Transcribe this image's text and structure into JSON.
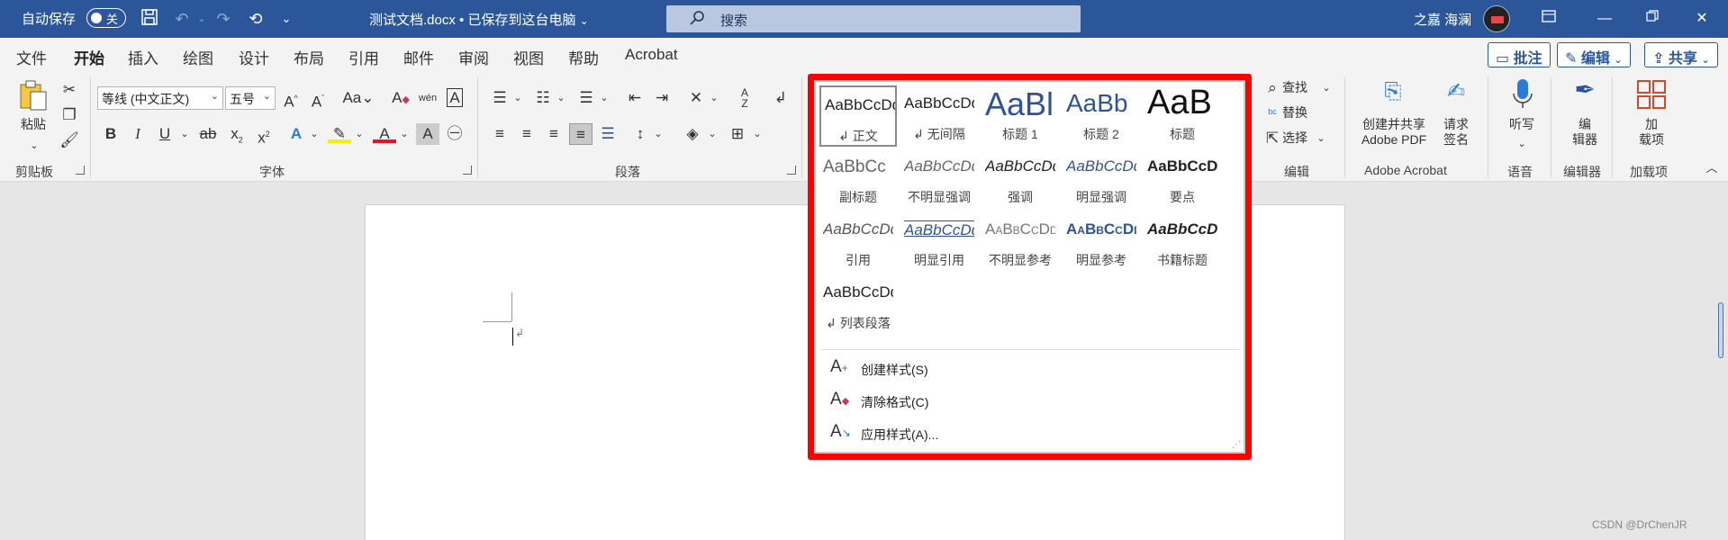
{
  "titlebar": {
    "autosave_label": "自动保存",
    "autosave_state": "关",
    "doc_title": "测试文档.docx • 已保存到这台电脑",
    "search_placeholder": "搜索",
    "user_name": "之嘉 海澜"
  },
  "tabs": [
    "文件",
    "开始",
    "插入",
    "绘图",
    "设计",
    "布局",
    "引用",
    "邮件",
    "审阅",
    "视图",
    "帮助",
    "Acrobat"
  ],
  "active_tab": "开始",
  "ribbon_actions": {
    "comment": "批注",
    "edit": "编辑",
    "share": "共享"
  },
  "groups": {
    "clipboard": {
      "label": "剪贴板",
      "paste": "粘贴"
    },
    "font": {
      "label": "字体",
      "font_name": "等线 (中文正文)",
      "font_size": "五号"
    },
    "paragraph": {
      "label": "段落"
    },
    "editing": {
      "label": "编辑",
      "find": "查找",
      "replace": "替换",
      "select": "选择"
    },
    "adobe": {
      "label": "Adobe Acrobat",
      "create_pdf": "创建并共享",
      "create_pdf2": "Adobe PDF",
      "request_sign": "请求",
      "request_sign2": "签名"
    },
    "voice": {
      "label": "语音",
      "dictate": "听写"
    },
    "editor": {
      "label": "编辑器",
      "editor_btn": "编",
      "editor_btn2": "辑器"
    },
    "addins": {
      "label": "加载项",
      "addins_btn": "加",
      "addins_btn2": "载项"
    }
  },
  "styles": [
    {
      "sample": "AaBbCcDd",
      "name": "↲ 正文"
    },
    {
      "sample": "AaBbCcDd",
      "name": "↲ 无间隔"
    },
    {
      "sample": "AaBl",
      "name": "标题 1"
    },
    {
      "sample": "AaBb",
      "name": "标题 2"
    },
    {
      "sample": "AaB",
      "name": "标题"
    },
    {
      "sample": "AaBbCc",
      "name": "副标题"
    },
    {
      "sample": "AaBbCcDd",
      "name": "不明显强调"
    },
    {
      "sample": "AaBbCcDd",
      "name": "强调"
    },
    {
      "sample": "AaBbCcDd",
      "name": "明显强调"
    },
    {
      "sample": "AaBbCcD",
      "name": "要点"
    },
    {
      "sample": "AaBbCcDd",
      "name": "引用"
    },
    {
      "sample": "AaBbCcDd",
      "name": "明显引用"
    },
    {
      "sample": "AaBbCcDd",
      "name": "不明显参考"
    },
    {
      "sample": "AaBbCcDd",
      "name": "明显参考"
    },
    {
      "sample": "AaBbCcD",
      "name": "书籍标题"
    },
    {
      "sample": "AaBbCcDd",
      "name": "↲ 列表段落"
    }
  ],
  "gallery_commands": [
    "创建样式(S)",
    "清除格式(C)",
    "应用样式(A)..."
  ],
  "watermark": "CSDN @DrChenJR",
  "colors": {
    "accent": "#2b579a",
    "highlight_border": "#ff0000",
    "font_color_red": "#e81123",
    "highlight_yellow": "#ffeb00"
  }
}
